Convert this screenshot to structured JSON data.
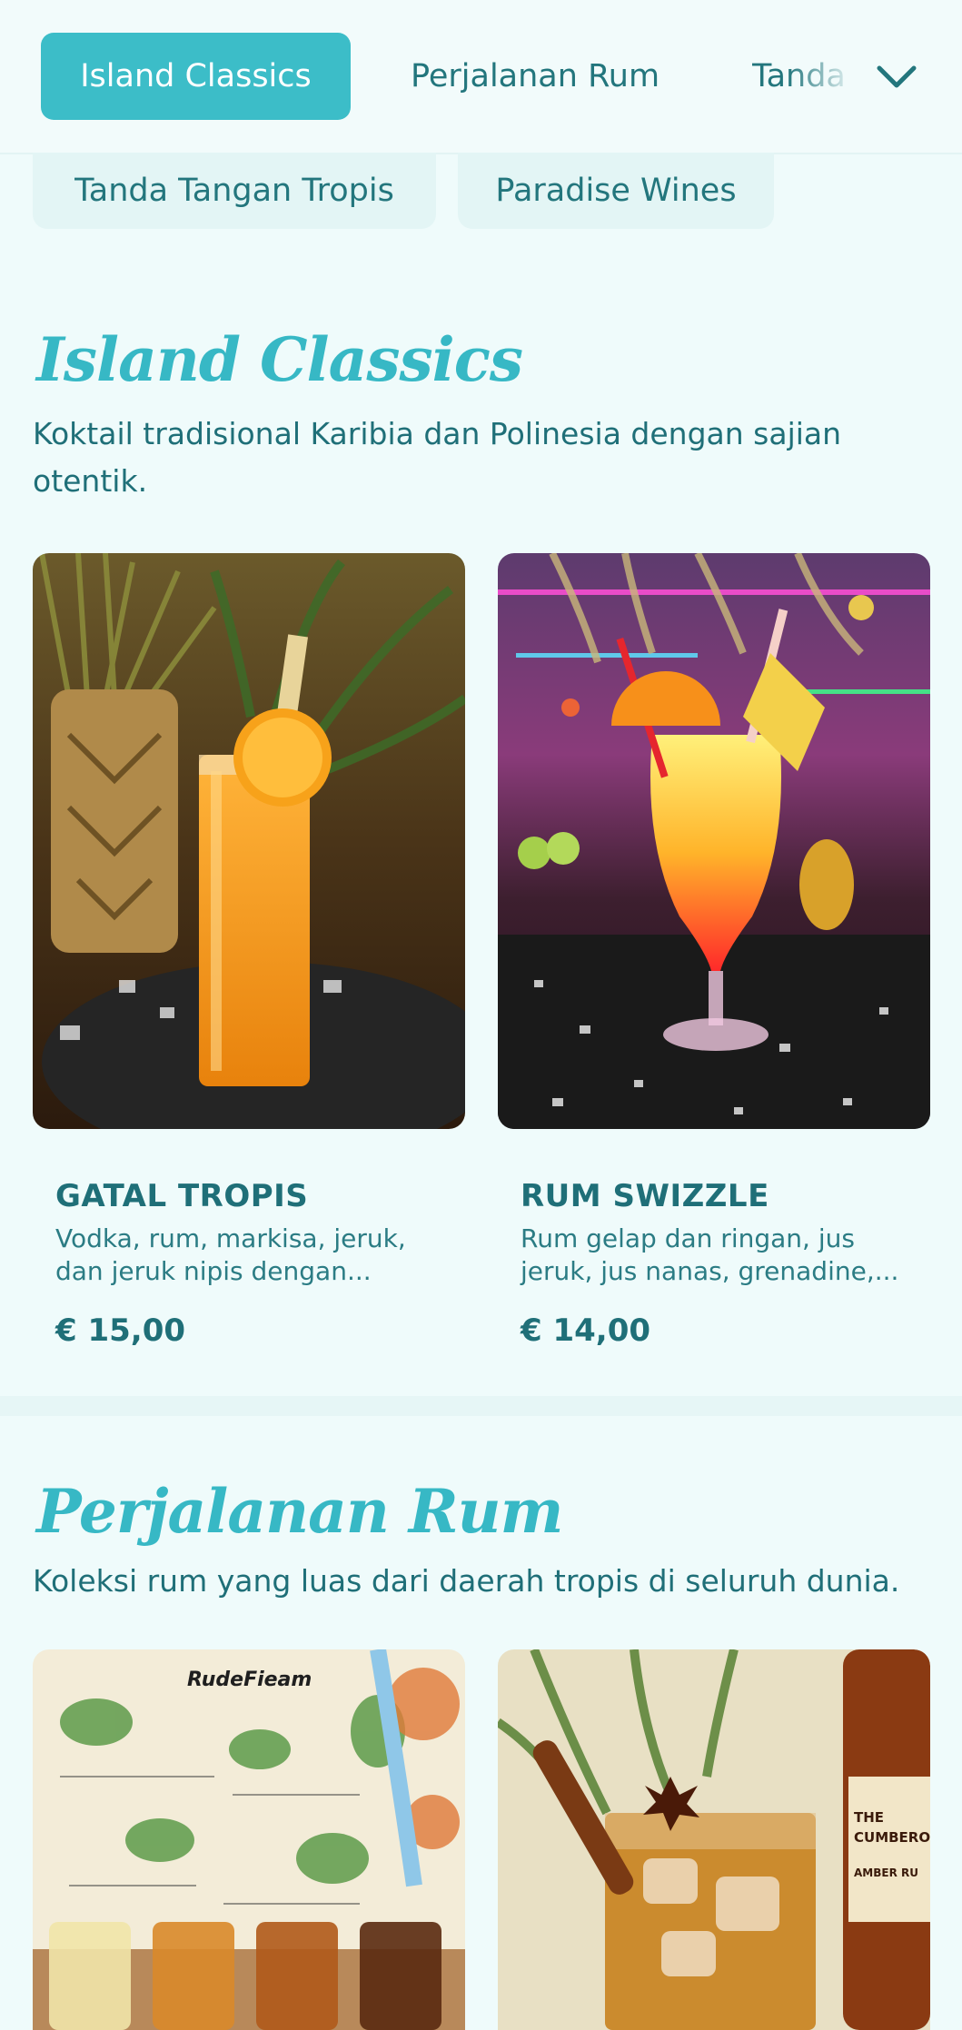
{
  "nav": {
    "tabs": [
      {
        "label": "Island Classics",
        "active": true
      },
      {
        "label": "Perjalanan Rum",
        "active": false
      },
      {
        "label": "Tanda",
        "active": false
      }
    ],
    "chips": [
      {
        "label": "Tanda Tangan Tropis"
      },
      {
        "label": "Paradise Wines"
      }
    ],
    "expand_icon": "chevron-down-icon"
  },
  "sections": [
    {
      "title": "Island Classics",
      "description": "Koktail tradisional Karibia dan Polinesia dengan sajian otentik.",
      "items": [
        {
          "name": "GATAL TROPIS",
          "description": "Vodka, rum, markisa, jeruk, dan jeruk nipis dengan...",
          "price": "€ 15,00"
        },
        {
          "name": "RUM SWIZZLE",
          "description": "Rum gelap dan ringan, jus jeruk, jus nanas, grenadine,...",
          "price": "€ 14,00"
        }
      ]
    },
    {
      "title": "Perjalanan Rum",
      "description": "Koleksi rum yang luas dari daerah tropis di seluruh dunia.",
      "items": [
        {
          "image_text": "RudeFieam"
        },
        {
          "image_text": "THE CUMBERO AMBER RU"
        }
      ]
    }
  ],
  "colors": {
    "accent": "#3cbdc8",
    "title": "#37b8c5",
    "text": "#1f6f78",
    "background": "#effbfb"
  }
}
